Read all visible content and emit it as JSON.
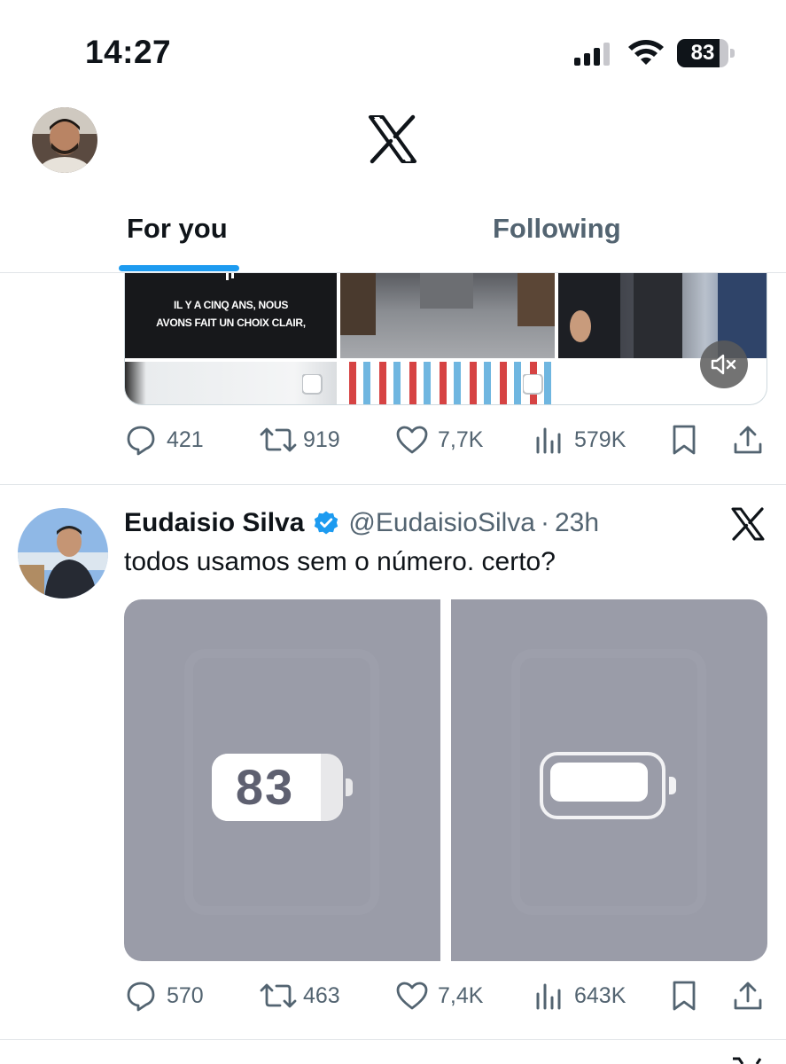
{
  "status_bar": {
    "time": "14:27",
    "battery_level": "83",
    "battery_fraction": 0.83
  },
  "header": {
    "logo_icon": "x-logo-icon",
    "tabs": [
      {
        "label": "For you",
        "active": true
      },
      {
        "label": "Following",
        "active": false
      }
    ],
    "accent_color": "#1d9bf0"
  },
  "tweet1": {
    "media_caption_line1": "IL Y A CINQ ANS, NOUS",
    "media_caption_line2": "AVONS FAIT UN CHOIX CLAIR,",
    "mute_icon": "volume-mute-icon",
    "actions": {
      "replies": "421",
      "reposts": "919",
      "likes": "7,7K",
      "views": "579K"
    }
  },
  "tweet2": {
    "author_name": "Eudaisio Silva",
    "verified_icon": "verified-badge-icon",
    "handle": "@EudaisioSilva",
    "separator": "·",
    "time": "23h",
    "text": "todos usamos sem o número. certo?",
    "media": {
      "left_battery_label": "83",
      "left_battery_fraction": 0.83
    },
    "actions": {
      "replies": "570",
      "reposts": "463",
      "likes": "7,4K",
      "views": "643K"
    }
  }
}
